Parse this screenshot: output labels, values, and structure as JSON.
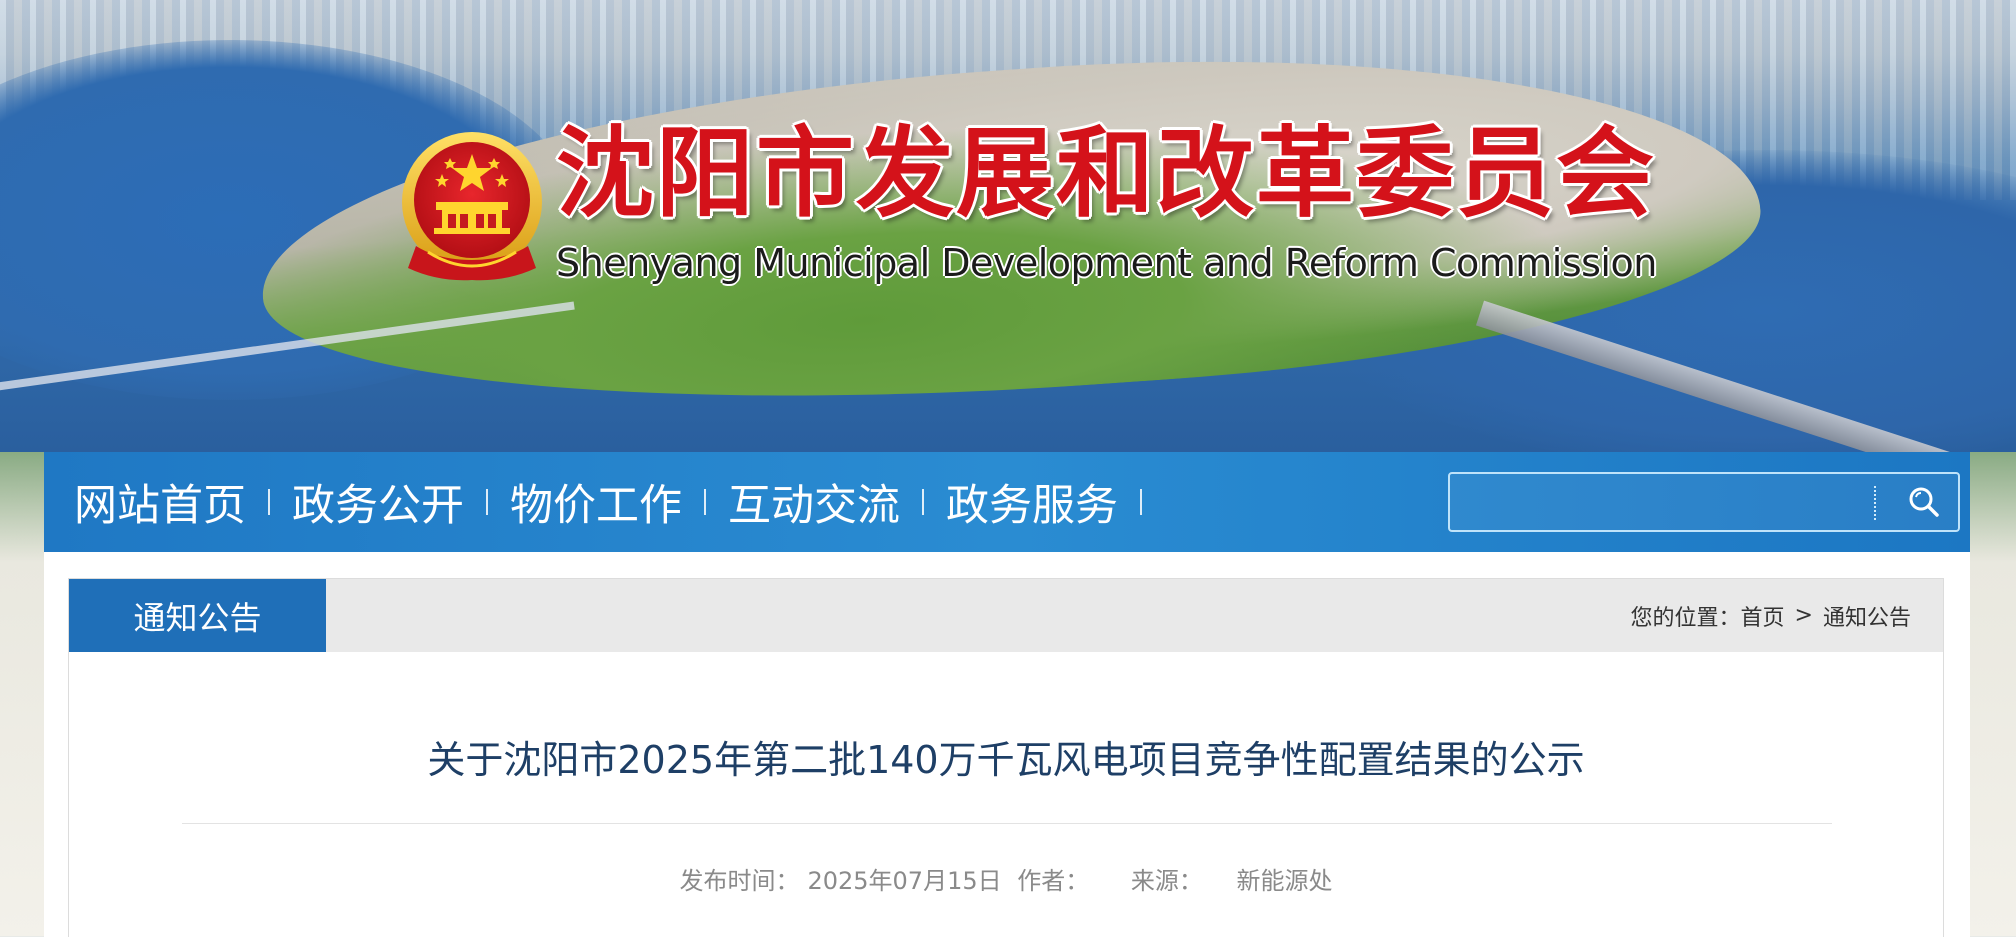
{
  "header": {
    "title_cn": "沈阳市发展和改革委员会",
    "title_en": "Shenyang Municipal Development and Reform Commission",
    "emblem_icon": "national-emblem-icon"
  },
  "nav": {
    "items": [
      {
        "label": "网站首页"
      },
      {
        "label": "政务公开"
      },
      {
        "label": "物价工作"
      },
      {
        "label": "互动交流"
      },
      {
        "label": "政务服务"
      }
    ],
    "search": {
      "value": "",
      "placeholder": "",
      "button_icon": "search-icon"
    }
  },
  "section": {
    "tab_label": "通知公告",
    "breadcrumb": {
      "prefix": "您的位置：",
      "home": "首页",
      "separator": ">",
      "current": "通知公告"
    }
  },
  "article": {
    "title": "关于沈阳市2025年第二批140万千瓦风电项目竞争性配置结果的公示",
    "meta": {
      "publish_label": "发布时间：",
      "publish_date": "2025年07月15日",
      "author_label": "作者：",
      "author": "",
      "source_label": "来源：",
      "source": "新能源处"
    }
  },
  "colors": {
    "nav_bg": "#2a8cd2",
    "tab_bg": "#1f6fb8",
    "title_red": "#d4121a",
    "article_title": "#1e3f66"
  }
}
